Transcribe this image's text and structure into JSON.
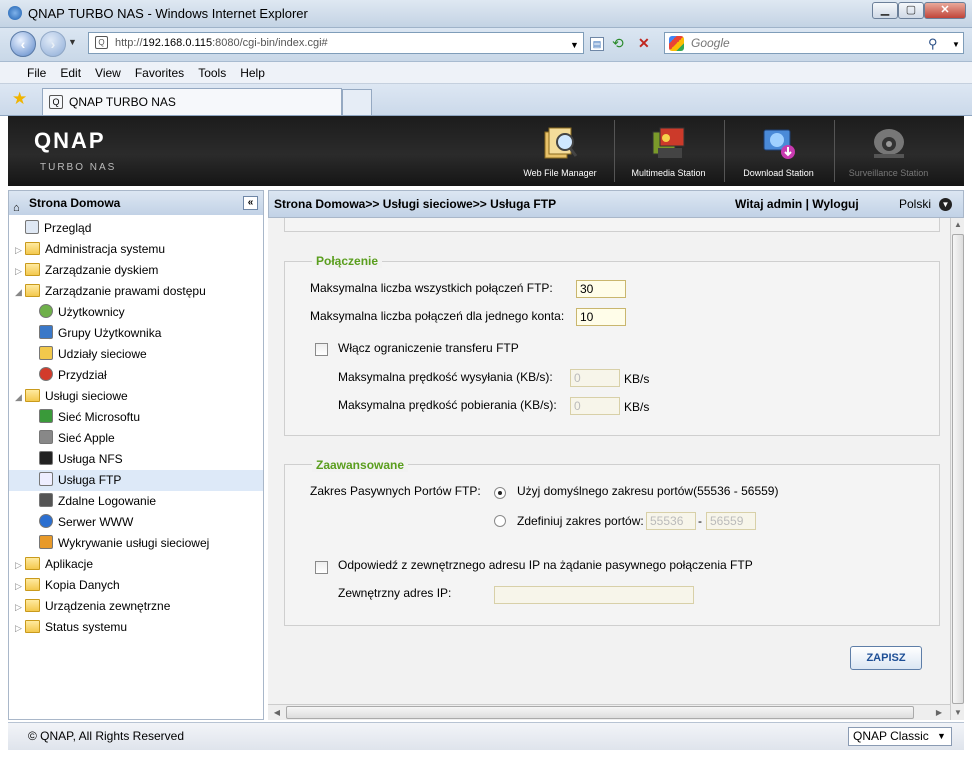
{
  "browser": {
    "window_title": "QNAP TURBO NAS - Windows Internet Explorer",
    "url_prefix": "http://",
    "url_host": "192.168.0.115",
    "url_rest": ":8080/cgi-bin/index.cgi#",
    "search_placeholder": "Google",
    "menu": [
      "File",
      "Edit",
      "View",
      "Favorites",
      "Tools",
      "Help"
    ],
    "tab_title": "QNAP TURBO NAS"
  },
  "header": {
    "logo": "QNAP",
    "subtitle": "TURBO NAS",
    "apps": [
      {
        "label": "Web File Manager",
        "icon": "web-file-manager-icon"
      },
      {
        "label": "Multimedia Station",
        "icon": "multimedia-station-icon"
      },
      {
        "label": "Download Station",
        "icon": "download-station-icon"
      },
      {
        "label": "Surveillance Station",
        "icon": "surveillance-station-icon"
      }
    ]
  },
  "sidebar": {
    "title": "Strona Domowa",
    "items": [
      {
        "label": "Przegląd",
        "indent": 1,
        "icon": "overview-icon"
      },
      {
        "label": "Administracja systemu",
        "indent": 0,
        "icon": "folder-icon",
        "twisty": "▷"
      },
      {
        "label": "Zarządzanie dyskiem",
        "indent": 0,
        "icon": "folder-icon",
        "twisty": "▷"
      },
      {
        "label": "Zarządzanie prawami dostępu",
        "indent": 0,
        "icon": "folder-open-icon",
        "twisty": "◢"
      },
      {
        "label": "Użytkownicy",
        "indent": 2,
        "icon": "user-icon"
      },
      {
        "label": "Grupy Użytkownika",
        "indent": 2,
        "icon": "user-group-icon"
      },
      {
        "label": "Udziały sieciowe",
        "indent": 2,
        "icon": "share-folder-icon"
      },
      {
        "label": "Przydział",
        "indent": 2,
        "icon": "quota-icon"
      },
      {
        "label": "Usługi sieciowe",
        "indent": 0,
        "icon": "folder-open-icon",
        "twisty": "◢"
      },
      {
        "label": "Sieć Microsoftu",
        "indent": 2,
        "icon": "windows-icon"
      },
      {
        "label": "Sieć Apple",
        "indent": 2,
        "icon": "apple-icon"
      },
      {
        "label": "Usługa NFS",
        "indent": 2,
        "icon": "linux-icon"
      },
      {
        "label": "Usługa FTP",
        "indent": 2,
        "icon": "ftp-icon",
        "selected": true
      },
      {
        "label": "Zdalne Logowanie",
        "indent": 2,
        "icon": "remote-login-icon"
      },
      {
        "label": "Serwer WWW",
        "indent": 2,
        "icon": "web-server-icon"
      },
      {
        "label": "Wykrywanie usługi sieciowej",
        "indent": 2,
        "icon": "service-discovery-icon"
      },
      {
        "label": "Aplikacje",
        "indent": 0,
        "icon": "folder-icon",
        "twisty": "▷"
      },
      {
        "label": "Kopia Danych",
        "indent": 0,
        "icon": "folder-icon",
        "twisty": "▷"
      },
      {
        "label": "Urządzenia zewnętrzne",
        "indent": 0,
        "icon": "folder-icon",
        "twisty": "▷"
      },
      {
        "label": "Status systemu",
        "indent": 0,
        "icon": "folder-icon",
        "twisty": "▷"
      }
    ]
  },
  "topbar": {
    "breadcrumb": "Strona Domowa>> Usługi sieciowe>> Usługa FTP",
    "greeting": "Witaj admin | Wyloguj",
    "language": "Polski"
  },
  "connection": {
    "legend": "Połączenie",
    "max_all_label": "Maksymalna liczba wszystkich połączeń FTP:",
    "max_all_value": "30",
    "max_account_label": "Maksymalna liczba połączeń dla jednego konta:",
    "max_account_value": "10",
    "limit_label": "Włącz ograniczenie transferu FTP",
    "upload_label": "Maksymalna prędkość wysyłania (KB/s):",
    "upload_value": "0",
    "download_label": "Maksymalna prędkość pobierania (KB/s):",
    "download_value": "0",
    "unit": "KB/s"
  },
  "advanced": {
    "legend": "Zaawansowane",
    "passive_label": "Zakres Pasywnych Portów FTP:",
    "default_option": "Użyj domyślnego zakresu portów(55536 - 56559)",
    "custom_option": "Zdefiniuj zakres portów:",
    "port_from": "55536",
    "port_sep": "-",
    "port_to": "56559",
    "external_label": "Odpowiedź z zewnętrznego adresu IP na żądanie pasywnego połączenia FTP",
    "ext_ip_label": "Zewnętrzny adres IP:",
    "ext_ip_value": ""
  },
  "save_label": "ZAPISZ",
  "footer": {
    "copyright": "© QNAP, All Rights Reserved",
    "theme": "QNAP Classic"
  }
}
